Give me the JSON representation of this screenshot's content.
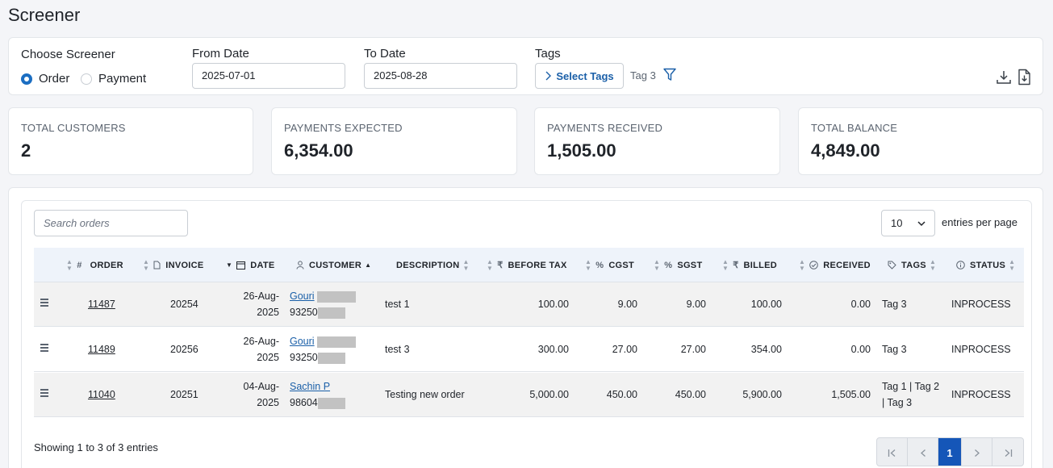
{
  "page_title": "Screener",
  "filters": {
    "screener_label": "Choose Screener",
    "options": [
      {
        "label": "Order",
        "selected": true
      },
      {
        "label": "Payment",
        "selected": false
      }
    ],
    "from_label": "From Date",
    "from_value": "2025-07-01",
    "to_label": "To Date",
    "to_value": "2025-08-28",
    "tags_label": "Tags",
    "select_tags_label": "Select Tags",
    "selected_tag": "Tag 3",
    "icons": [
      "chevron-right-icon",
      "filter-icon",
      "download-icon",
      "export-file-icon"
    ]
  },
  "stats": [
    {
      "label": "TOTAL CUSTOMERS",
      "value": "2"
    },
    {
      "label": "PAYMENTS EXPECTED",
      "value": "6,354.00"
    },
    {
      "label": "PAYMENTS RECEIVED",
      "value": "1,505.00"
    },
    {
      "label": "TOTAL BALANCE",
      "value": "4,849.00"
    }
  ],
  "table": {
    "search_placeholder": "Search orders",
    "per_page_value": "10",
    "per_page_label": "entries per page",
    "columns": {
      "order": "ORDER",
      "invoice": "INVOICE",
      "date": "DATE",
      "customer": "CUSTOMER",
      "description": "DESCRIPTION",
      "before_tax": "BEFORE TAX",
      "cgst": "CGST",
      "sgst": "SGST",
      "billed": "BILLED",
      "received": "RECEIVED",
      "tags": "TAGS",
      "status": "STATUS"
    },
    "rows": [
      {
        "order": "11487",
        "invoice": "20254",
        "date_1": "26-Aug-",
        "date_2": "2025",
        "customer": "Gouri",
        "phone": "93250",
        "description": "test 1",
        "before_tax": "100.00",
        "cgst": "9.00",
        "sgst": "9.00",
        "billed": "100.00",
        "received": "0.00",
        "tags_1": "Tag 3",
        "tags_2": "",
        "status": "INPROCESS"
      },
      {
        "order": "11489",
        "invoice": "20256",
        "date_1": "26-Aug-",
        "date_2": "2025",
        "customer": "Gouri",
        "phone": "93250",
        "description": "test 3",
        "before_tax": "300.00",
        "cgst": "27.00",
        "sgst": "27.00",
        "billed": "354.00",
        "received": "0.00",
        "tags_1": "Tag 3",
        "tags_2": "",
        "status": "INPROCESS"
      },
      {
        "order": "11040",
        "invoice": "20251",
        "date_1": "04-Aug-",
        "date_2": "2025",
        "customer": "Sachin P",
        "phone": "98604",
        "description": "Testing new order",
        "before_tax": "5,000.00",
        "cgst": "450.00",
        "sgst": "450.00",
        "billed": "5,900.00",
        "received": "1,505.00",
        "tags_1": "Tag 1 | Tag 2",
        "tags_2": "| Tag 3",
        "status": "INPROCESS"
      }
    ],
    "showing": "Showing 1 to 3 of 3 entries",
    "pager": {
      "current_page": "1"
    }
  }
}
